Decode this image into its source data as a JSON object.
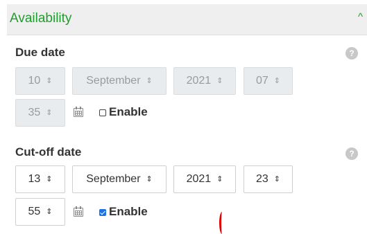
{
  "header": {
    "title": "Availability",
    "collapse_icon": "chevron-up-icon"
  },
  "due_date": {
    "label": "Due date",
    "help": "?",
    "day": "10",
    "month": "September",
    "year": "2021",
    "hour": "07",
    "minute": "35",
    "enabled": false,
    "enable_label": "Enable"
  },
  "cutoff_date": {
    "label": "Cut-off date",
    "help": "?",
    "day": "13",
    "month": "September",
    "year": "2021",
    "hour": "23",
    "minute": "55",
    "enabled": true,
    "enable_label": "Enable"
  },
  "arrow": "⇕",
  "colors": {
    "accent": "#1e9e2d",
    "checkbox": "#1a73e8",
    "disabled_bg": "#e9ecef"
  }
}
